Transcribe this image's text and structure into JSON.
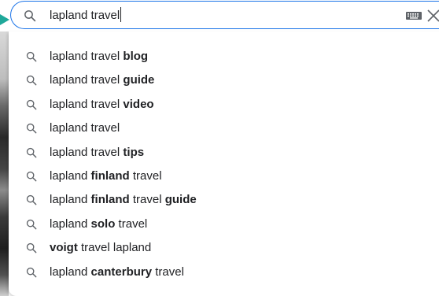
{
  "search": {
    "query": "lapland travel",
    "accent_color": "#1a73e8"
  },
  "pointer": {
    "color": "#1fa89a"
  },
  "icons": {
    "search": "search-icon",
    "keyboard": "keyboard-icon",
    "clear": "close-icon",
    "suggestion": "search-icon"
  },
  "suggestions": [
    {
      "parts": [
        {
          "t": "lapland travel ",
          "b": false
        },
        {
          "t": "blog",
          "b": true
        }
      ]
    },
    {
      "parts": [
        {
          "t": "lapland travel ",
          "b": false
        },
        {
          "t": "guide",
          "b": true
        }
      ]
    },
    {
      "parts": [
        {
          "t": "lapland travel ",
          "b": false
        },
        {
          "t": "video",
          "b": true
        }
      ]
    },
    {
      "parts": [
        {
          "t": "lapland travel",
          "b": false
        }
      ]
    },
    {
      "parts": [
        {
          "t": "lapland travel ",
          "b": false
        },
        {
          "t": "tips",
          "b": true
        }
      ]
    },
    {
      "parts": [
        {
          "t": "lapland ",
          "b": false
        },
        {
          "t": "finland",
          "b": true
        },
        {
          "t": " travel",
          "b": false
        }
      ]
    },
    {
      "parts": [
        {
          "t": "lapland ",
          "b": false
        },
        {
          "t": "finland",
          "b": true
        },
        {
          "t": " travel ",
          "b": false
        },
        {
          "t": "guide",
          "b": true
        }
      ]
    },
    {
      "parts": [
        {
          "t": "lapland ",
          "b": false
        },
        {
          "t": "solo",
          "b": true
        },
        {
          "t": " travel",
          "b": false
        }
      ]
    },
    {
      "parts": [
        {
          "t": "voigt",
          "b": true
        },
        {
          "t": " travel lapland",
          "b": false
        }
      ]
    },
    {
      "parts": [
        {
          "t": "lapland ",
          "b": false
        },
        {
          "t": "canterbury",
          "b": true
        },
        {
          "t": " travel",
          "b": false
        }
      ]
    }
  ]
}
